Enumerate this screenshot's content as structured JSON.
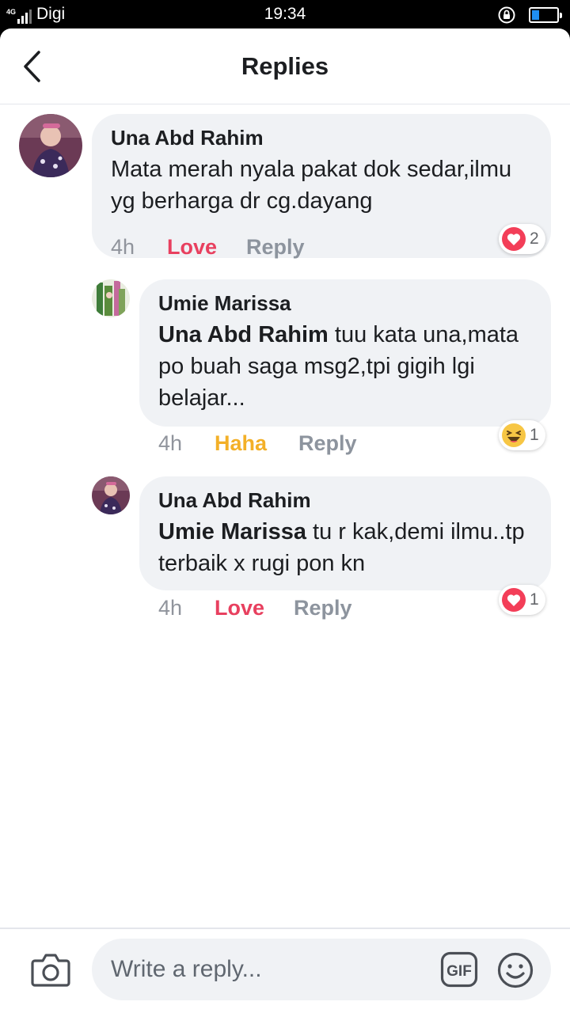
{
  "status_bar": {
    "network": "4G",
    "carrier": "Digi",
    "time": "19:34",
    "battery_level": 0.3
  },
  "header": {
    "title": "Replies",
    "back_icon": "chevron-left-icon"
  },
  "comments": [
    {
      "author": "Una Abd Rahim",
      "mention": "",
      "text": "Mata merah nyala pakat dok sedar,ilmu yg berharga dr cg.dayang",
      "time": "4h",
      "reaction_label": "Love",
      "reply_label": "Reply",
      "reaction_icon": "love-icon",
      "reaction_count": "2"
    },
    {
      "author": "Umie Marissa",
      "mention": "Una Abd Rahim",
      "text": " tuu kata una,mata po buah saga msg2,tpi gigih lgi belajar...",
      "time": "4h",
      "reaction_label": "Haha",
      "reply_label": "Reply",
      "reaction_icon": "haha-icon",
      "reaction_count": "1"
    },
    {
      "author": "Una Abd Rahim",
      "mention": "Umie Marissa",
      "text": " tu r kak,demi ilmu..tp terbaik x rugi pon kn",
      "time": "4h",
      "reaction_label": "Love",
      "reply_label": "Reply",
      "reaction_icon": "love-icon",
      "reaction_count": "1"
    }
  ],
  "composer": {
    "placeholder": "Write a reply...",
    "camera_icon": "camera-icon",
    "gif_label": "GIF",
    "emoji_icon": "smiley-icon"
  },
  "colors": {
    "love": "#e8405f",
    "haha": "#f3b028",
    "bubble": "#f0f2f5",
    "battery": "#1f8ef1"
  }
}
